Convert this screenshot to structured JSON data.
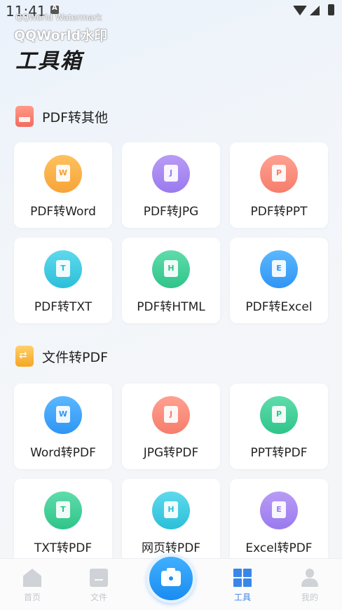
{
  "status_bar": {
    "time": "11:41"
  },
  "watermark": {
    "line1": "QQWorld Watermark",
    "line2": "QQWorld水印"
  },
  "page_title": "工具箱",
  "sections": [
    {
      "title": "PDF转其他",
      "tools": [
        {
          "label": "PDF转Word",
          "glyph": "W",
          "color": "orange"
        },
        {
          "label": "PDF转JPG",
          "glyph": "J",
          "color": "purple"
        },
        {
          "label": "PDF转PPT",
          "glyph": "P",
          "color": "salmon"
        },
        {
          "label": "PDF转TXT",
          "glyph": "T",
          "color": "cyan"
        },
        {
          "label": "PDF转HTML",
          "glyph": "H",
          "color": "green"
        },
        {
          "label": "PDF转Excel",
          "glyph": "E",
          "color": "blue"
        }
      ]
    },
    {
      "title": "文件转PDF",
      "tools": [
        {
          "label": "Word转PDF",
          "glyph": "W",
          "color": "blue"
        },
        {
          "label": "JPG转PDF",
          "glyph": "J",
          "color": "salmon"
        },
        {
          "label": "PPT转PDF",
          "glyph": "P",
          "color": "green"
        },
        {
          "label": "TXT转PDF",
          "glyph": "T",
          "color": "green"
        },
        {
          "label": "网页转PDF",
          "glyph": "H",
          "color": "cyan"
        },
        {
          "label": "Excel转PDF",
          "glyph": "E",
          "color": "purple"
        }
      ]
    }
  ],
  "bottom_nav": {
    "items": [
      {
        "label": "首页",
        "icon": "home-icon"
      },
      {
        "label": "文件",
        "icon": "folder-icon"
      },
      {
        "label": "工具",
        "icon": "tools-icon",
        "active": true
      },
      {
        "label": "我的",
        "icon": "profile-icon"
      }
    ],
    "camera_icon": "camera-icon"
  },
  "colors": {
    "accent": "#3a86e8",
    "orange": "#f7a437",
    "purple": "#9a7aee",
    "salmon": "#f67d6b",
    "cyan": "#2bbfd9",
    "green": "#2fc48a",
    "blue": "#2f95f5"
  }
}
